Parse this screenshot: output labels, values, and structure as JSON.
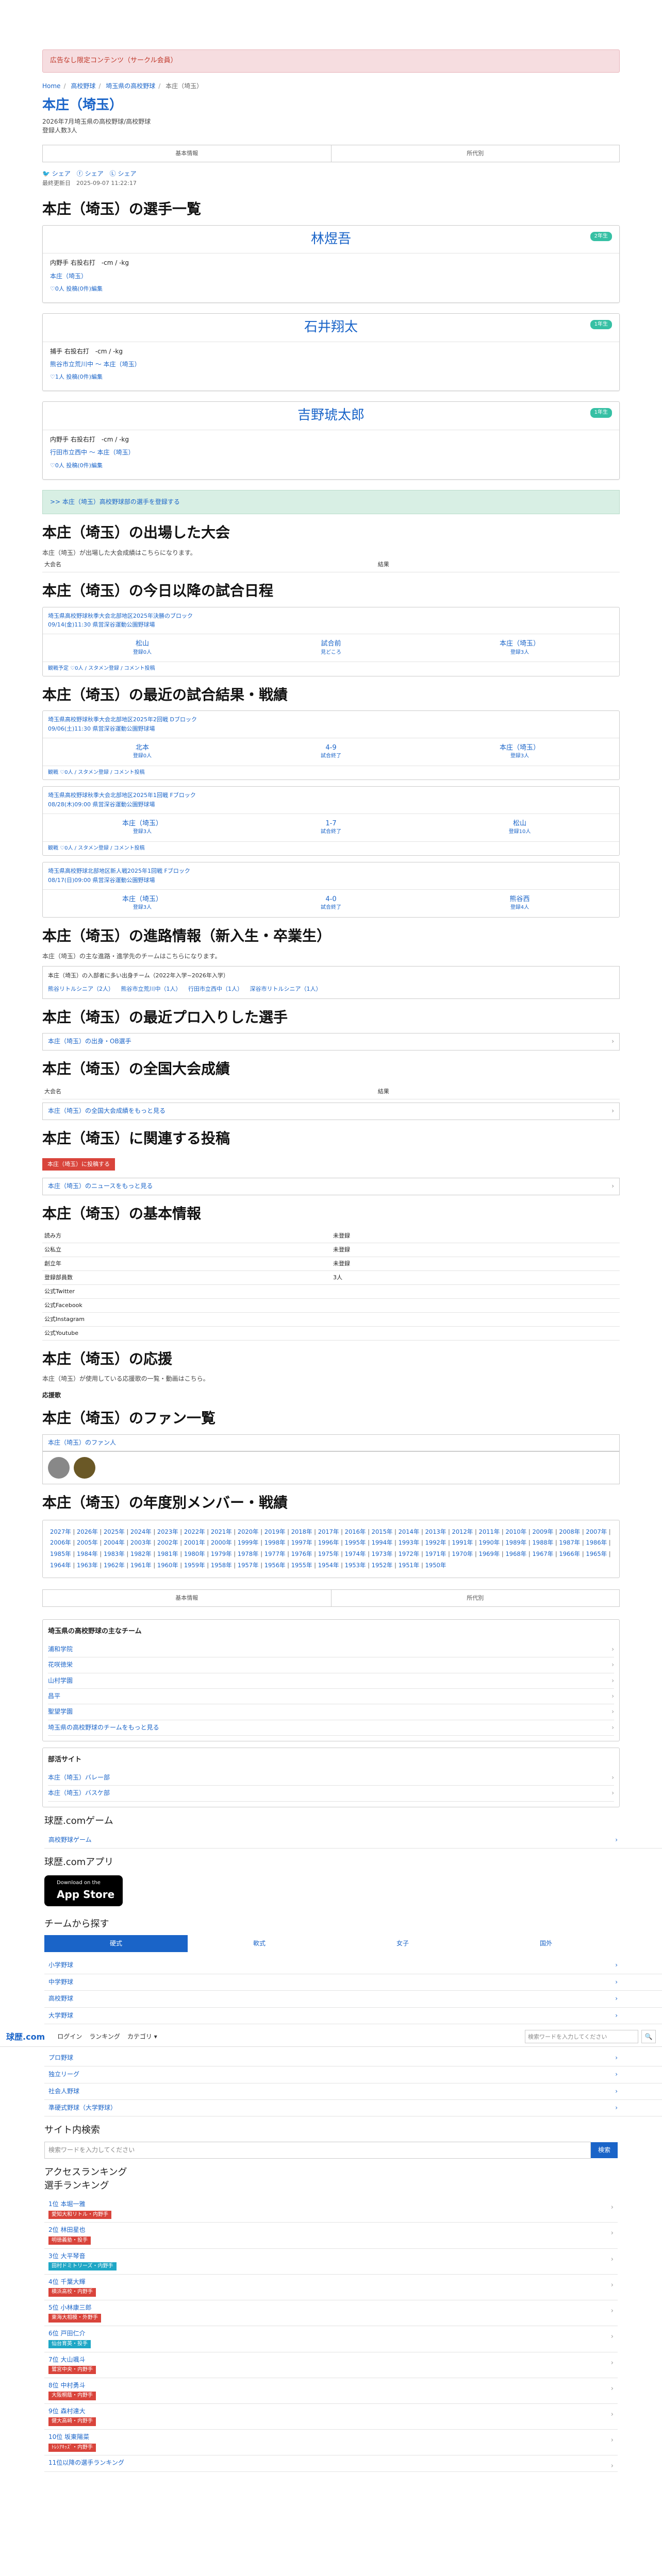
{
  "ad": "広告なし限定コンテンツ（サークル会員）",
  "breadcrumb": [
    "Home",
    "高校野球",
    "埼玉県の高校野球",
    "本庄（埼玉）"
  ],
  "team": {
    "name": "本庄（埼玉）",
    "sub1": "2026年7月埼玉県の高校野球/高校野球",
    "sub2": "登録人数3人"
  },
  "tabs": [
    "基本情報",
    "所代別"
  ],
  "share": [
    "シェア",
    "シェア",
    "シェア"
  ],
  "updated": "最終更新日　2025-09-07 11:22:17",
  "players_heading": "本庄（埼玉）の選手一覧",
  "players": [
    {
      "name": "林煜吾",
      "badge": "2年生",
      "position": "内野手 右投右打　-cm / -kg",
      "team": "本庄（埼玉）",
      "likes": "♡0人 投稿(0件)編集"
    },
    {
      "name": "石井翔太",
      "badge": "1年生",
      "position": "捕手 右投右打　-cm / -kg",
      "team": "熊谷市立荒川中 〜 本庄（埼玉）",
      "likes": "♡1人 投稿(0件)編集"
    },
    {
      "name": "吉野琥太郎",
      "badge": "1年生",
      "position": "内野手 右投右打　-cm / -kg",
      "team": "行田市立西中 〜 本庄（埼玉）",
      "likes": "♡0人 投稿(0件)編集"
    }
  ],
  "player_register": ">> 本庄（埼玉）高校野球部の選手を登録する",
  "tourn_heading": "本庄（埼玉）の出場した大会",
  "tourn_desc": "本庄（埼玉）が出場した大会成績はこちらになります。",
  "tourn_cols": [
    "大会名",
    "結果"
  ],
  "today_heading": "本庄（埼玉）の今日以降の試合日程",
  "today_game": {
    "title": "埼玉県高校野球秋季大会北部地区2025年決勝のブロック",
    "date": "09/14(金)11:30 県営深谷運動公園野球場",
    "home": "松山",
    "home_sub": "登録0人",
    "score": "試合前",
    "score_sub": "見どころ",
    "away": "本庄（埼玉）",
    "away_sub": "登録3人",
    "foot": "観戦予定 ♡0人 / スタメン登録 / コメント投稿"
  },
  "recent_heading": "本庄（埼玉）の最近の試合結果・戦績",
  "recent_games": [
    {
      "title": "埼玉県高校野球秋季大会北部地区2025年2回戦 Dブロック",
      "date": "09/06(土)11:30 県営深谷運動公園野球場",
      "home": "北本",
      "home_sub": "登録0人",
      "score": "4-9",
      "score_sub": "試合終了",
      "away": "本庄（埼玉）",
      "away_sub": "登録3人",
      "foot": "観戦 ♡0人 / スタメン登録 / コメント投稿"
    },
    {
      "title": "埼玉県高校野球秋季大会北部地区2025年1回戦 Fブロック",
      "date": "08/28(木)09:00 県営深谷運動公園野球場",
      "home": "本庄（埼玉）",
      "home_sub": "登録3人",
      "score": "1-7",
      "score_sub": "試合終了",
      "away": "松山",
      "away_sub": "登録10人",
      "foot": "観戦 ♡0人 / スタメン登録 / コメント投稿"
    },
    {
      "title": "埼玉県高校野球北部地区新人戦2025年1回戦 Fブロック",
      "date": "08/17(日)09:00 県営深谷運動公園野球場",
      "home": "本庄（埼玉）",
      "home_sub": "登録3人",
      "score": "4-0",
      "score_sub": "試合終了",
      "away": "熊谷西",
      "away_sub": "登録4人",
      "foot": ""
    }
  ],
  "career_heading": "本庄（埼玉）の進路情報（新入生・卒業生）",
  "career_desc": "本庄（埼玉）の主な進路・進学先のチームはこちらになります。",
  "career_box": {
    "title": "本庄（埼玉）の入部者に多い出身チーム（2022年入学~2026年入学）",
    "links": [
      "熊谷リトルシニア（2人）",
      "熊谷市立荒川中（1人）",
      "行田市立西中（1人）",
      "深谷市リトルシニア（1人）"
    ]
  },
  "pro_heading": "本庄（埼玉）の最近プロ入りした選手",
  "pro_link": "本庄（埼玉）の出身・OB選手",
  "national_heading": "本庄（埼玉）の全国大会成績",
  "national_cols": [
    "大会名",
    "結果"
  ],
  "national_link": "本庄（埼玉）の全国大会成績をもっと見る",
  "posts_heading": "本庄（埼玉）に関連する投稿",
  "post_button": "本庄（埼玉）に投稿する",
  "news_link": "本庄（埼玉）のニュースをもっと見る",
  "basic_heading": "本庄（埼玉）の基本情報",
  "basic_rows": [
    [
      "読み方",
      "未登録"
    ],
    [
      "公私立",
      "未登録"
    ],
    [
      "創立年",
      "未登録"
    ],
    [
      "登録部員数",
      "3人"
    ],
    [
      "公式Twitter",
      ""
    ],
    [
      "公式Facebook",
      ""
    ],
    [
      "公式Instagram",
      ""
    ],
    [
      "公式Youtube",
      ""
    ]
  ],
  "support_heading": "本庄（埼玉）の応援",
  "support_desc": "本庄（埼玉）が使用している応援歌の一覧・動画はこちら。",
  "support_sub": "応援歌",
  "fans_heading": "本庄（埼玉）のファン一覧",
  "fans_link": "本庄（埼玉）のファン人",
  "yearly_heading": "本庄（埼玉）の年度別メンバー・戦績",
  "years": [
    "2027年",
    "2026年",
    "2025年",
    "2024年",
    "2023年",
    "2022年",
    "2021年",
    "2020年",
    "2019年",
    "2018年",
    "2017年",
    "2016年",
    "2015年",
    "2014年",
    "2013年",
    "2012年",
    "2011年",
    "2010年",
    "2009年",
    "2008年",
    "2007年",
    "2006年",
    "2005年",
    "2004年",
    "2003年",
    "2002年",
    "2001年",
    "2000年",
    "1999年",
    "1998年",
    "1997年",
    "1996年",
    "1995年",
    "1994年",
    "1993年",
    "1992年",
    "1991年",
    "1990年",
    "1989年",
    "1988年",
    "1987年",
    "1986年",
    "1985年",
    "1984年",
    "1983年",
    "1982年",
    "1981年",
    "1980年",
    "1979年",
    "1978年",
    "1977年",
    "1976年",
    "1975年",
    "1974年",
    "1973年",
    "1972年",
    "1971年",
    "1970年",
    "1969年",
    "1968年",
    "1967年",
    "1966年",
    "1965年",
    "1964年",
    "1963年",
    "1962年",
    "1961年",
    "1960年",
    "1959年",
    "1958年",
    "1957年",
    "1956年",
    "1955年",
    "1954年",
    "1953年",
    "1952年",
    "1951年",
    "1950年"
  ],
  "tabs2": [
    "基本情報",
    "所代別"
  ],
  "saitama_box": {
    "title": "埼玉県の高校野球の主なチーム",
    "items": [
      "浦和学院",
      "花咲徳栄",
      "山村学園",
      "昌平",
      "聖望学園",
      "埼玉県の高校野球のチームをもっと見る"
    ]
  },
  "other_box": {
    "title": "部活サイト",
    "items": [
      "本庄（埼玉）バレー部",
      "本庄（埼玉）バスケ部"
    ]
  },
  "footer": {
    "game_title": "球歴.comゲーム",
    "game_item": "高校野球ゲーム",
    "app_title": "球歴.comアプリ",
    "appstore_small": "Download on the",
    "appstore_big": "App Store",
    "teams_title": "チームから探す",
    "seg": [
      "硬式",
      "軟式",
      "女子",
      "国外"
    ],
    "team_items": [
      "小学野球",
      "中学野球",
      "高校野球",
      "大学野球"
    ],
    "navbar_logo": "球歴.com",
    "navbar_items": [
      "ログイン",
      "ランキング",
      "カテゴリ ▾"
    ],
    "navbar_search": "検索ワードを入力してください",
    "team_items2": [
      "プロ野球",
      "独立リーグ",
      "社会人野球",
      "準硬式野球（大学野球）"
    ],
    "site_search_title": "サイト内検索",
    "site_search_placeholder": "検索ワードを入力してください",
    "site_search_btn": "検索",
    "access_title": "アクセスランキング",
    "rank_title": "選手ランキング",
    "rank_items": [
      {
        "n": "1位 本堀一雅",
        "b": "愛知大和リトル・内野手",
        "c": "#d9443b"
      },
      {
        "n": "2位 林田星也",
        "b": "明徳義塾・投手",
        "c": "#d9443b"
      },
      {
        "n": "3位 大平琴音",
        "b": "田村ドミトリーズ・内野手",
        "c": "#1fa7c6"
      },
      {
        "n": "4位 千葉大輝",
        "b": "横浜高校・内野手",
        "c": "#d9443b"
      },
      {
        "n": "5位 小林康三郎",
        "b": "東海大相模・外野手",
        "c": "#d9443b"
      },
      {
        "n": "6位 戸田仁介",
        "b": "仙台育英・投手",
        "c": "#1fa7c6"
      },
      {
        "n": "7位 大山颯斗",
        "b": "鷺宮中央・内野手",
        "c": "#d9443b"
      },
      {
        "n": "8位 中村勇斗",
        "b": "大阪桐蔭・内野手",
        "c": "#d9443b"
      },
      {
        "n": "9位 森村達大",
        "b": "健大高崎・内野手",
        "c": "#d9443b"
      },
      {
        "n": "10位 坂東陽菜",
        "b": "ﾄﾚｼｱｷｯｽﾞ・内野手",
        "c": "#d9443b"
      }
    ],
    "rank_more": "11位以降の選手ランキング"
  }
}
